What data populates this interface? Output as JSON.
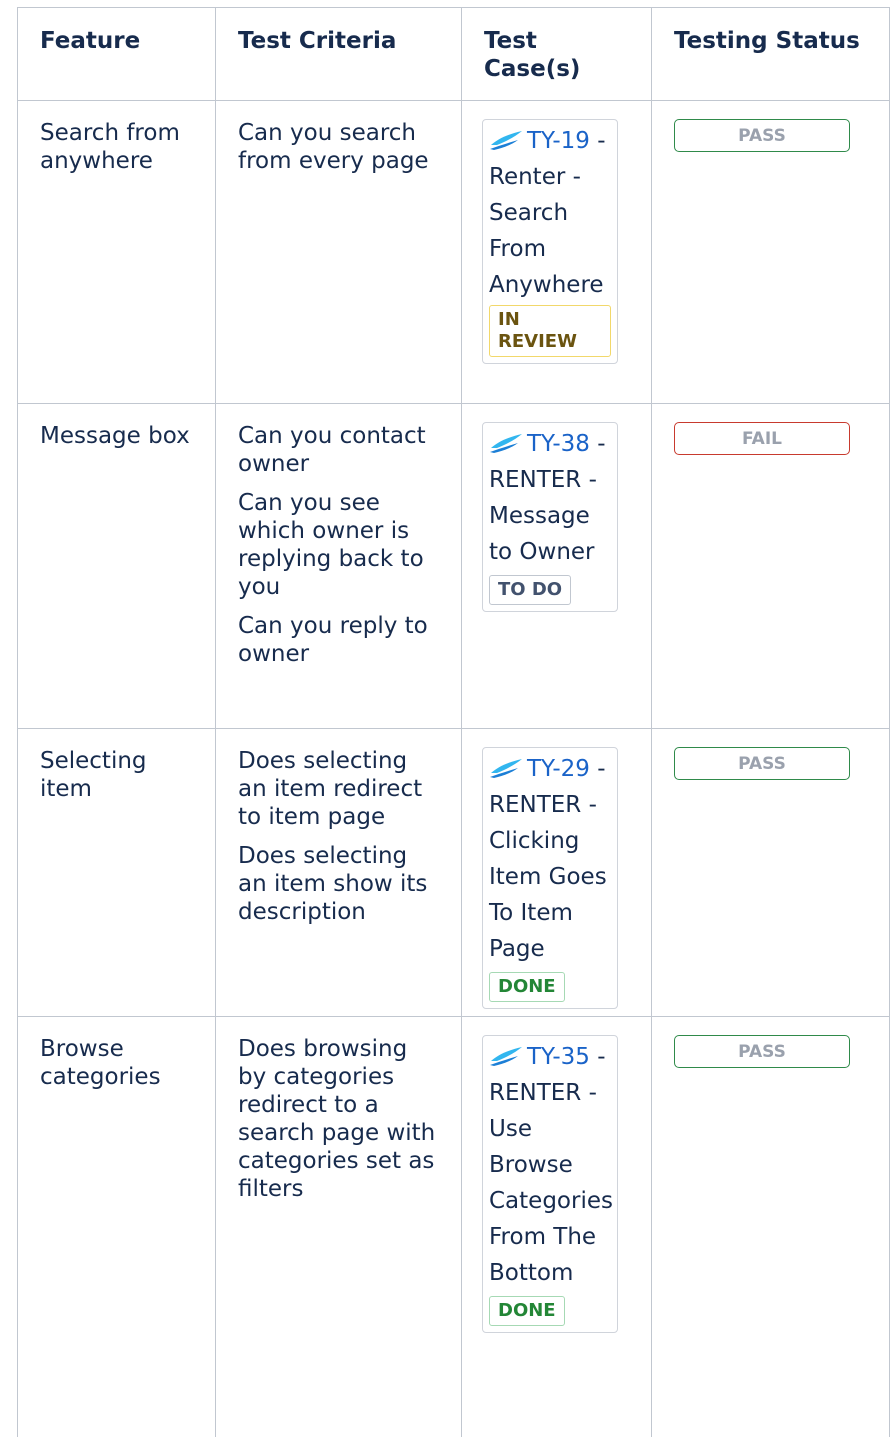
{
  "headers": {
    "feature": "Feature",
    "criteria": "Test Criteria",
    "cases": "Test Case(s)",
    "status": "Testing Status"
  },
  "rows": [
    {
      "feature": "Search from anywhere",
      "criteria": [
        "Can you search from every page"
      ],
      "case_key": "TY-19",
      "case_title": " - Renter - Search From Anywhere",
      "case_status": "IN REVIEW",
      "testing_status": "PASS"
    },
    {
      "feature": "Message box",
      "criteria": [
        "Can you contact owner",
        "Can you see which owner is replying back to you",
        "Can you reply to owner"
      ],
      "case_key": "TY-38",
      "case_title": " - RENTER - Message to Owner",
      "case_status": "TO DO",
      "testing_status": "FAIL"
    },
    {
      "feature": "Selecting item",
      "criteria": [
        "Does selecting an item redirect to item page",
        "Does selecting an item show its description"
      ],
      "case_key": "TY-29",
      "case_title": " - RENTER - Clicking Item Goes To Item Page",
      "case_status": "DONE",
      "testing_status": "PASS"
    },
    {
      "feature": "Browse categories",
      "criteria": [
        "Does browsing by categories redirect to a search page with categories set as filters"
      ],
      "case_key": "TY-35",
      "case_title": " - RENTER - Use Browse Categories From The Bottom",
      "case_status": "DONE",
      "testing_status": "PASS"
    }
  ],
  "colors": {
    "link": "#1a63c8",
    "pass_border": "#2f8a4a",
    "fail_border": "#c83a2e",
    "in_review": "#6b5410",
    "to_do": "#42526e",
    "done": "#238636"
  },
  "icons": {
    "test_case": "jira-xray-feather-icon"
  }
}
